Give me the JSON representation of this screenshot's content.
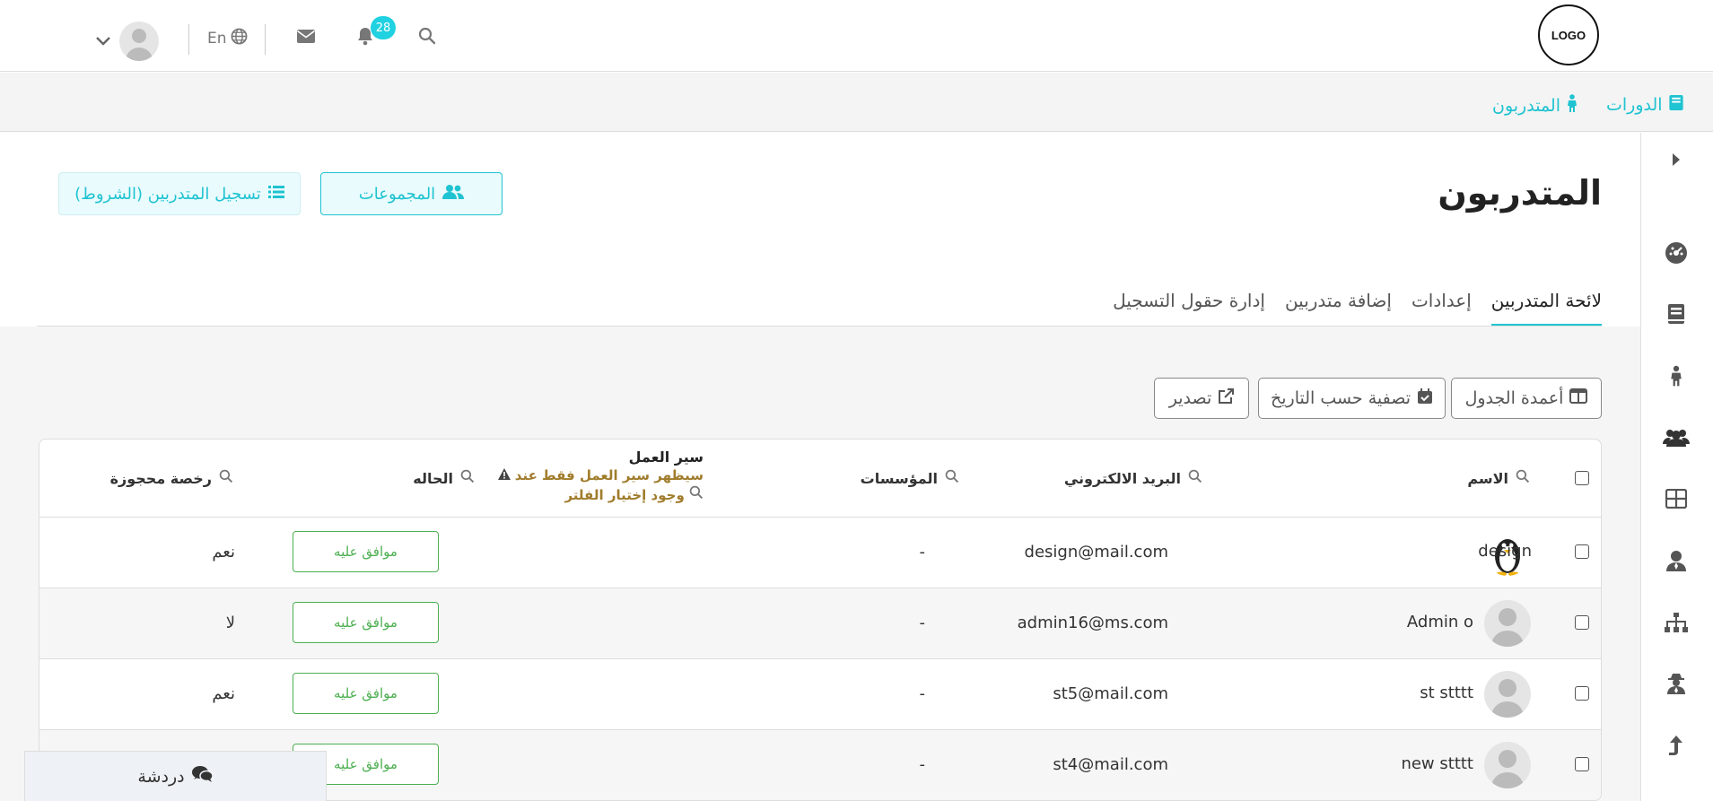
{
  "header": {
    "logo_text": "LOGO",
    "notifications_count": "28",
    "language": "En"
  },
  "breadcrumbs": [
    {
      "label": "الدورات",
      "icon": "book-icon"
    },
    {
      "label": "المتدربون",
      "icon": "person-icon"
    }
  ],
  "page": {
    "title": "المتدربون",
    "groups_button": "المجموعات",
    "register_button": "تسجيل المتدربين (الشروط)"
  },
  "tabs": [
    {
      "label": "لائحة المتدربين",
      "active": true
    },
    {
      "label": "إعدادات"
    },
    {
      "label": "إضافة متدربين"
    },
    {
      "label": "إدارة حقول التسجيل"
    }
  ],
  "toolbar": {
    "columns": "أعمدة الجدول",
    "date_filter": "تصفية حسب التاريخ",
    "export": "تصدير"
  },
  "table": {
    "headers": {
      "name": "الاسم",
      "email": "البريد الالكتروني",
      "institutions": "المؤسسات",
      "workflow": "سير العمل",
      "workflow_warning": "سيظهر سير العمل فقط عند وجود إختيار الفلتر",
      "status": "الحاله",
      "reserved_license": "رخصة محجوزة"
    },
    "rows": [
      {
        "name": "design",
        "email": "design@mail.com",
        "institutions": "-",
        "status": "موافق عليه",
        "license": "نعم",
        "avatar": "penguin"
      },
      {
        "name": "Admin o",
        "email": "admin16@ms.com",
        "institutions": "-",
        "status": "موافق عليه",
        "license": "لا",
        "avatar": "default"
      },
      {
        "name": "st stttt",
        "email": "st5@mail.com",
        "institutions": "-",
        "status": "موافق عليه",
        "license": "نعم",
        "avatar": "default"
      },
      {
        "name": "new stttt",
        "email": "st4@mail.com",
        "institutions": "-",
        "status": "موافق عليه",
        "license": "",
        "avatar": "default"
      }
    ]
  },
  "chat": {
    "label": "دردشة"
  },
  "colors": {
    "accent": "#1fc3d1",
    "badge": "#1fd1e1",
    "approved": "#4caf50",
    "warning": "#a07c2c"
  }
}
